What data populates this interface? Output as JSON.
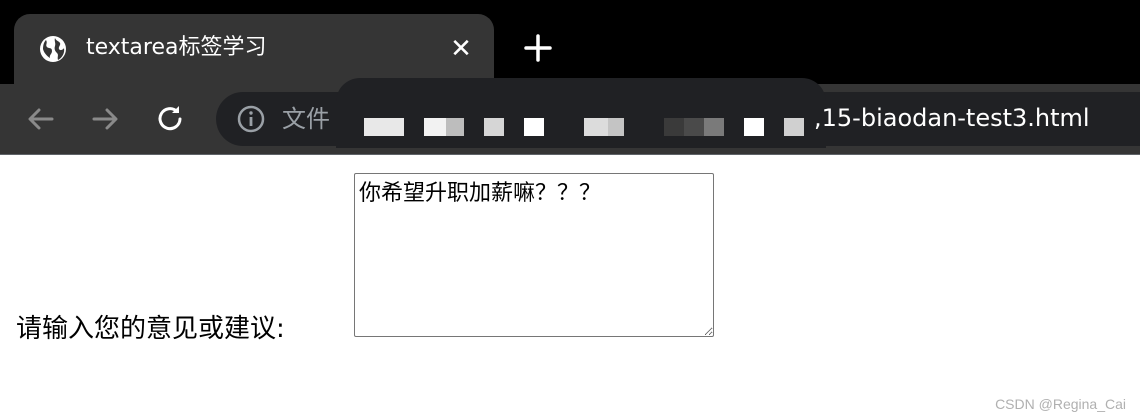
{
  "tab": {
    "title": "textarea标签学习",
    "close_glyph": "✕"
  },
  "toolbar": {
    "url_prefix": "文件",
    "url_suffix": ",15-biaodan-test3.html"
  },
  "page": {
    "label": "请输入您的意见或建议:",
    "textarea_value": "你希望升职加薪嘛？？？"
  },
  "watermark": "CSDN @Regina_Cai",
  "icons": {
    "tab": "globe-icon",
    "close": "close-icon",
    "new_tab": "plus-icon",
    "back": "back-arrow-icon",
    "forward": "forward-arrow-icon",
    "reload": "reload-icon",
    "info": "info-icon"
  },
  "colors": {
    "chrome_background": "#000000",
    "tab_background": "#353535",
    "omnibox_background": "#202124",
    "disabled_icon": "#8a8a8a"
  }
}
